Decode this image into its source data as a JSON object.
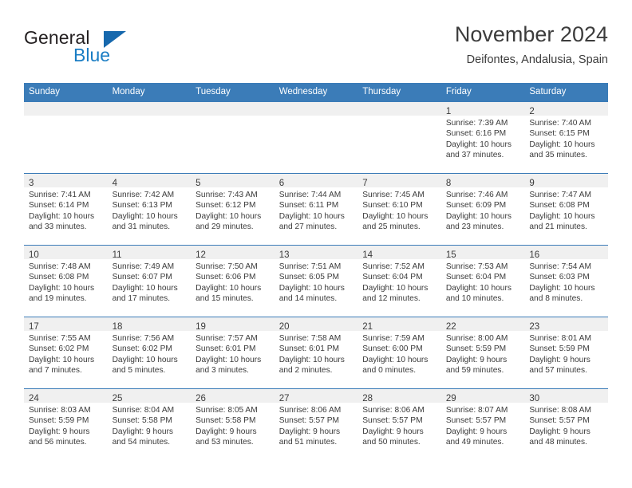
{
  "brand": {
    "word_one": "General",
    "word_two": "Blue",
    "triangle_color": "#1668ad",
    "blue_text_color": "#1a7dc4"
  },
  "header": {
    "title": "November 2024",
    "subtitle": "Deifontes, Andalusia, Spain"
  },
  "theme": {
    "header_blue": "#3b7cb8",
    "daynum_band": "#f0f0f0",
    "text": "#3b3b3b"
  },
  "weekday_headers": [
    "Sunday",
    "Monday",
    "Tuesday",
    "Wednesday",
    "Thursday",
    "Friday",
    "Saturday"
  ],
  "weeks": [
    [
      {
        "day": "",
        "lines": []
      },
      {
        "day": "",
        "lines": []
      },
      {
        "day": "",
        "lines": []
      },
      {
        "day": "",
        "lines": []
      },
      {
        "day": "",
        "lines": []
      },
      {
        "day": "1",
        "lines": [
          "Sunrise: 7:39 AM",
          "Sunset: 6:16 PM",
          "Daylight: 10 hours",
          "and 37 minutes."
        ]
      },
      {
        "day": "2",
        "lines": [
          "Sunrise: 7:40 AM",
          "Sunset: 6:15 PM",
          "Daylight: 10 hours",
          "and 35 minutes."
        ]
      }
    ],
    [
      {
        "day": "3",
        "lines": [
          "Sunrise: 7:41 AM",
          "Sunset: 6:14 PM",
          "Daylight: 10 hours",
          "and 33 minutes."
        ]
      },
      {
        "day": "4",
        "lines": [
          "Sunrise: 7:42 AM",
          "Sunset: 6:13 PM",
          "Daylight: 10 hours",
          "and 31 minutes."
        ]
      },
      {
        "day": "5",
        "lines": [
          "Sunrise: 7:43 AM",
          "Sunset: 6:12 PM",
          "Daylight: 10 hours",
          "and 29 minutes."
        ]
      },
      {
        "day": "6",
        "lines": [
          "Sunrise: 7:44 AM",
          "Sunset: 6:11 PM",
          "Daylight: 10 hours",
          "and 27 minutes."
        ]
      },
      {
        "day": "7",
        "lines": [
          "Sunrise: 7:45 AM",
          "Sunset: 6:10 PM",
          "Daylight: 10 hours",
          "and 25 minutes."
        ]
      },
      {
        "day": "8",
        "lines": [
          "Sunrise: 7:46 AM",
          "Sunset: 6:09 PM",
          "Daylight: 10 hours",
          "and 23 minutes."
        ]
      },
      {
        "day": "9",
        "lines": [
          "Sunrise: 7:47 AM",
          "Sunset: 6:08 PM",
          "Daylight: 10 hours",
          "and 21 minutes."
        ]
      }
    ],
    [
      {
        "day": "10",
        "lines": [
          "Sunrise: 7:48 AM",
          "Sunset: 6:08 PM",
          "Daylight: 10 hours",
          "and 19 minutes."
        ]
      },
      {
        "day": "11",
        "lines": [
          "Sunrise: 7:49 AM",
          "Sunset: 6:07 PM",
          "Daylight: 10 hours",
          "and 17 minutes."
        ]
      },
      {
        "day": "12",
        "lines": [
          "Sunrise: 7:50 AM",
          "Sunset: 6:06 PM",
          "Daylight: 10 hours",
          "and 15 minutes."
        ]
      },
      {
        "day": "13",
        "lines": [
          "Sunrise: 7:51 AM",
          "Sunset: 6:05 PM",
          "Daylight: 10 hours",
          "and 14 minutes."
        ]
      },
      {
        "day": "14",
        "lines": [
          "Sunrise: 7:52 AM",
          "Sunset: 6:04 PM",
          "Daylight: 10 hours",
          "and 12 minutes."
        ]
      },
      {
        "day": "15",
        "lines": [
          "Sunrise: 7:53 AM",
          "Sunset: 6:04 PM",
          "Daylight: 10 hours",
          "and 10 minutes."
        ]
      },
      {
        "day": "16",
        "lines": [
          "Sunrise: 7:54 AM",
          "Sunset: 6:03 PM",
          "Daylight: 10 hours",
          "and 8 minutes."
        ]
      }
    ],
    [
      {
        "day": "17",
        "lines": [
          "Sunrise: 7:55 AM",
          "Sunset: 6:02 PM",
          "Daylight: 10 hours",
          "and 7 minutes."
        ]
      },
      {
        "day": "18",
        "lines": [
          "Sunrise: 7:56 AM",
          "Sunset: 6:02 PM",
          "Daylight: 10 hours",
          "and 5 minutes."
        ]
      },
      {
        "day": "19",
        "lines": [
          "Sunrise: 7:57 AM",
          "Sunset: 6:01 PM",
          "Daylight: 10 hours",
          "and 3 minutes."
        ]
      },
      {
        "day": "20",
        "lines": [
          "Sunrise: 7:58 AM",
          "Sunset: 6:01 PM",
          "Daylight: 10 hours",
          "and 2 minutes."
        ]
      },
      {
        "day": "21",
        "lines": [
          "Sunrise: 7:59 AM",
          "Sunset: 6:00 PM",
          "Daylight: 10 hours",
          "and 0 minutes."
        ]
      },
      {
        "day": "22",
        "lines": [
          "Sunrise: 8:00 AM",
          "Sunset: 5:59 PM",
          "Daylight: 9 hours",
          "and 59 minutes."
        ]
      },
      {
        "day": "23",
        "lines": [
          "Sunrise: 8:01 AM",
          "Sunset: 5:59 PM",
          "Daylight: 9 hours",
          "and 57 minutes."
        ]
      }
    ],
    [
      {
        "day": "24",
        "lines": [
          "Sunrise: 8:03 AM",
          "Sunset: 5:59 PM",
          "Daylight: 9 hours",
          "and 56 minutes."
        ]
      },
      {
        "day": "25",
        "lines": [
          "Sunrise: 8:04 AM",
          "Sunset: 5:58 PM",
          "Daylight: 9 hours",
          "and 54 minutes."
        ]
      },
      {
        "day": "26",
        "lines": [
          "Sunrise: 8:05 AM",
          "Sunset: 5:58 PM",
          "Daylight: 9 hours",
          "and 53 minutes."
        ]
      },
      {
        "day": "27",
        "lines": [
          "Sunrise: 8:06 AM",
          "Sunset: 5:57 PM",
          "Daylight: 9 hours",
          "and 51 minutes."
        ]
      },
      {
        "day": "28",
        "lines": [
          "Sunrise: 8:06 AM",
          "Sunset: 5:57 PM",
          "Daylight: 9 hours",
          "and 50 minutes."
        ]
      },
      {
        "day": "29",
        "lines": [
          "Sunrise: 8:07 AM",
          "Sunset: 5:57 PM",
          "Daylight: 9 hours",
          "and 49 minutes."
        ]
      },
      {
        "day": "30",
        "lines": [
          "Sunrise: 8:08 AM",
          "Sunset: 5:57 PM",
          "Daylight: 9 hours",
          "and 48 minutes."
        ]
      }
    ]
  ]
}
